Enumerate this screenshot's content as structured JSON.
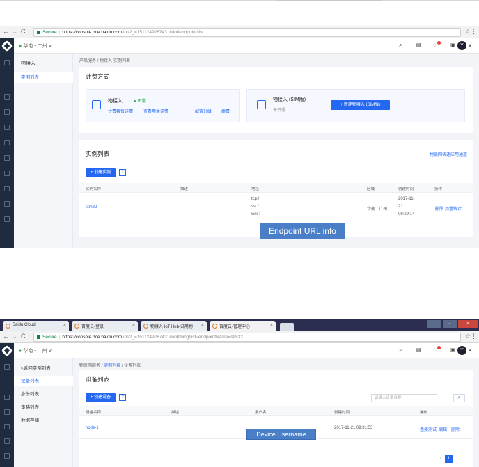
{
  "shot1": {
    "browser": {
      "url_secure": "Secure",
      "url_host": "https://console.bce.baidu.com",
      "url_path": "/iot/?_=1511249287431#/iot/endpoint/list"
    },
    "header": {
      "region": "华南 - 广州",
      "avatar_letter": "Y"
    },
    "subnav": {
      "title": "物接入",
      "items": [
        {
          "label": "实例列表"
        }
      ]
    },
    "breadcrumb": {
      "root": "产品服务",
      "sep": "/",
      "current": "物接入-实例列表"
    },
    "billing": {
      "title": "计费方式",
      "left": {
        "name": "物接入",
        "status": "● 正常",
        "links": [
          "计费套餐详情",
          "查看用量详情",
          "配置升级",
          "续费"
        ]
      },
      "right": {
        "name": "物接入 (SIM版)",
        "status": "未开通",
        "button": "新建物接入 (SIM版)"
      }
    },
    "instances": {
      "title": "实例列表",
      "quick_link": "物联网快速应用通道",
      "create_button": "创建实例",
      "columns": [
        "实例名称",
        "描述",
        "地址",
        "区域",
        "创建时间",
        "操作"
      ],
      "rows": [
        {
          "name": "stm32",
          "addr_lines": [
            "tcp:/",
            "ssl:/",
            "wss:"
          ],
          "region": "华南 - 广州",
          "created_lines": [
            "2017-11-",
            "21",
            "09:29:14"
          ],
          "actions": [
            "删除",
            "用量统计"
          ]
        }
      ]
    },
    "callout": "Endpoint URL info"
  },
  "shot2": {
    "tabs": [
      {
        "label": "Baidu Cloud"
      },
      {
        "label": "百度云-登录"
      },
      {
        "label": "物接入 IoT Hub-试用物"
      },
      {
        "label": "百度云-管理中心"
      }
    ],
    "browser": {
      "url_secure": "Secure",
      "url_host": "https://console.bce.baidu.com",
      "url_path": "/iot/?_=1511249287431#/iot/thing/list~endpointName=stm32"
    },
    "header": {
      "region": "华南 - 广州",
      "avatar_letter": "Y"
    },
    "subnav": {
      "back": "<返回实例列表",
      "items": [
        {
          "label": "设备列表"
        },
        {
          "label": "身份列表"
        },
        {
          "label": "策略列表"
        },
        {
          "label": "数据存储"
        }
      ]
    },
    "breadcrumb": {
      "root": "物联网服务",
      "sep": "/",
      "mid": "实例列表",
      "current": "设备列表"
    },
    "devices": {
      "title": "设备列表",
      "create_button": "创建设备",
      "search_placeholder": "请输入设备名称",
      "columns": [
        "设备名称",
        "描述",
        "用户名",
        "创建时间",
        "操作"
      ],
      "rows": [
        {
          "name": "node-1",
          "created": "2017-11-21 09:31:53",
          "actions": [
            "连接测试",
            "编辑",
            "删除"
          ]
        }
      ],
      "page": "1"
    },
    "callout": "Device Username"
  },
  "colors": {
    "accent": "#2468f2",
    "sidebar": "#1f2b3e",
    "callout": "#4a7fc8"
  }
}
